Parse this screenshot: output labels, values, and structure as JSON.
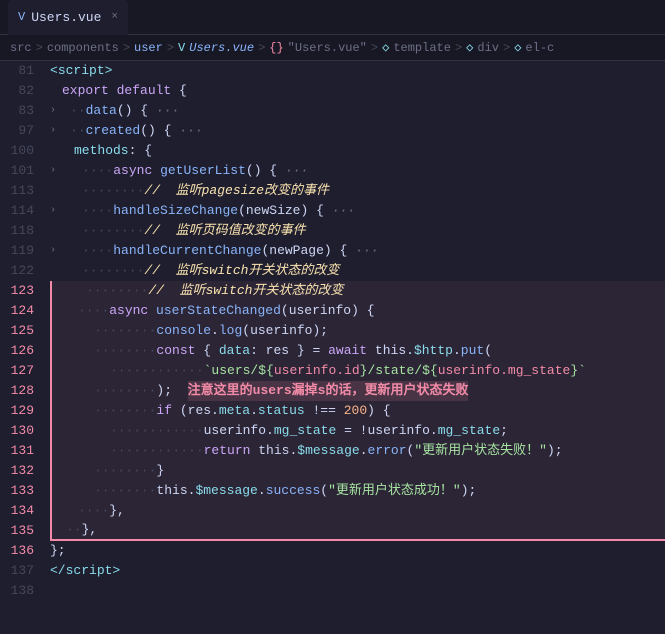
{
  "tab": {
    "icon": "V",
    "name": "Users.vue",
    "close": "×"
  },
  "breadcrumb": {
    "parts": [
      "src",
      ">",
      "components",
      ">",
      "user",
      ">",
      "V",
      "Users.vue",
      ">",
      "{}",
      "\"Users.vue\"",
      ">",
      "◇",
      "template",
      ">",
      "◇",
      "div",
      ">",
      "◇",
      "el-c"
    ]
  },
  "lines": [
    {
      "num": 81,
      "content": "line_81"
    },
    {
      "num": 82,
      "content": "line_82"
    },
    {
      "num": 83,
      "content": "line_83"
    },
    {
      "num": 97,
      "content": "line_97"
    },
    {
      "num": 100,
      "content": "line_100"
    },
    {
      "num": 101,
      "content": "line_101"
    },
    {
      "num": 113,
      "content": "line_113"
    },
    {
      "num": 114,
      "content": "line_114"
    },
    {
      "num": 118,
      "content": "line_118"
    },
    {
      "num": 119,
      "content": "line_119"
    },
    {
      "num": 122,
      "content": "line_122"
    },
    {
      "num": 123,
      "content": "line_123"
    },
    {
      "num": 124,
      "content": "line_124"
    },
    {
      "num": 125,
      "content": "line_125"
    },
    {
      "num": 126,
      "content": "line_126"
    },
    {
      "num": 127,
      "content": "line_127"
    },
    {
      "num": 128,
      "content": "line_128"
    },
    {
      "num": 129,
      "content": "line_129"
    },
    {
      "num": 130,
      "content": "line_130"
    },
    {
      "num": 131,
      "content": "line_131"
    },
    {
      "num": 132,
      "content": "line_132"
    },
    {
      "num": 133,
      "content": "line_133"
    },
    {
      "num": 134,
      "content": "line_134"
    },
    {
      "num": 135,
      "content": "line_135"
    },
    {
      "num": 136,
      "content": "line_136"
    },
    {
      "num": 137,
      "content": "line_137"
    },
    {
      "num": 138,
      "content": "line_138"
    }
  ]
}
